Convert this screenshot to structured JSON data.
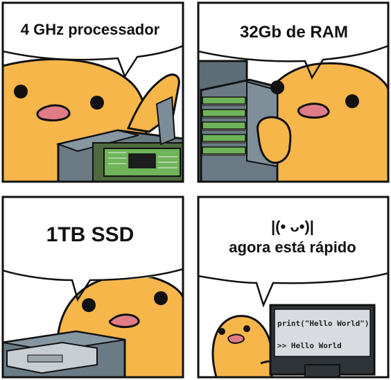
{
  "panels": [
    {
      "caption": "4 GHz processador"
    },
    {
      "caption": "32Gb de RAM"
    },
    {
      "caption": "1TB SSD"
    },
    {
      "caption_face": "|(• ᴗ•)|",
      "caption": "agora está rápido"
    }
  ],
  "monitor": {
    "line1": "print(\"Hello World\")",
    "line2": ">> Hello World"
  },
  "colors": {
    "character": "#F6B64A",
    "outline": "#111111",
    "background": "#FFFFFF",
    "hardware": "#5E6E78",
    "circuit_board": "#6FB35A",
    "mouth": "#E07C86"
  }
}
